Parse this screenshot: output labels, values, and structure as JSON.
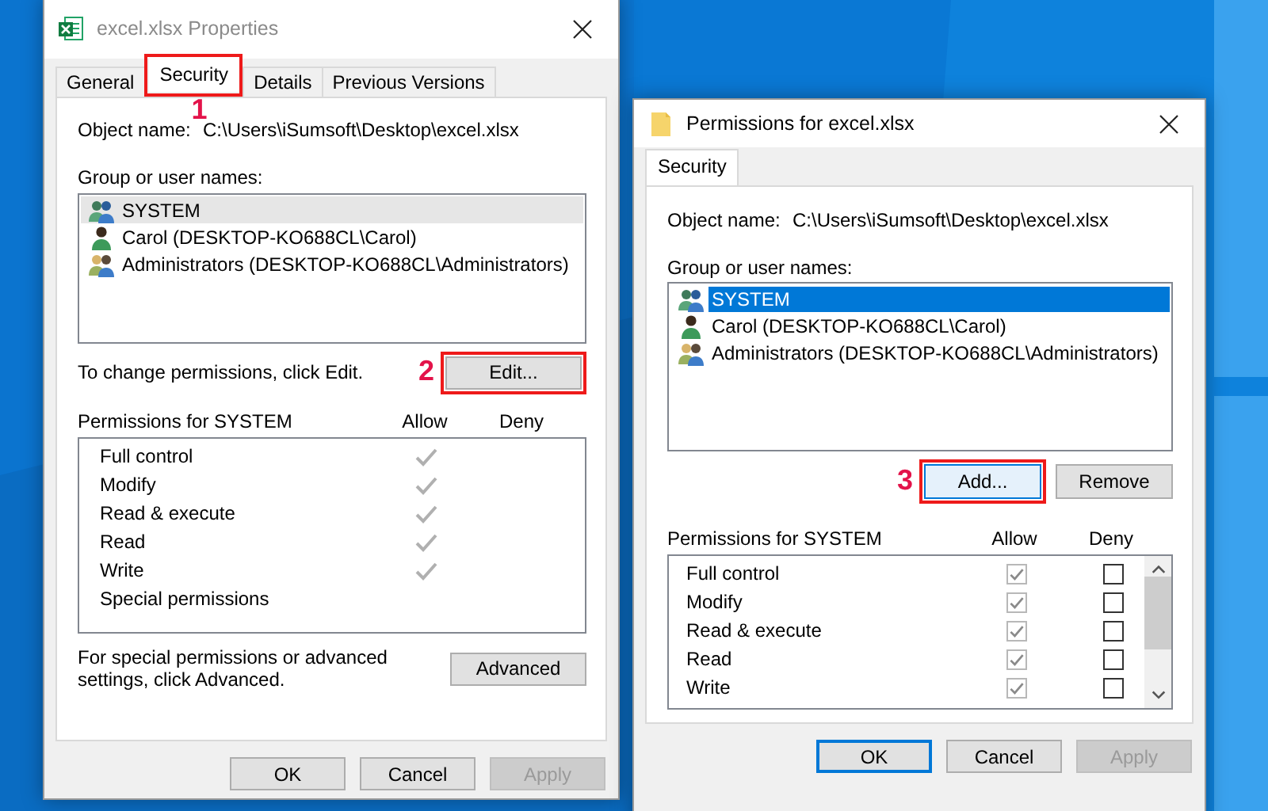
{
  "windows": [
    {
      "title": "excel.xlsx Properties",
      "kind": "properties",
      "active": false,
      "tabs": [
        {
          "label": "General",
          "selected": false,
          "highlighted": false
        },
        {
          "label": "Security",
          "selected": true,
          "highlighted": true,
          "step": "1"
        },
        {
          "label": "Details",
          "selected": false,
          "highlighted": false
        },
        {
          "label": "Previous Versions",
          "selected": false,
          "highlighted": false
        }
      ],
      "object_name_label": "Object name:",
      "object_name": "C:\\Users\\iSumsoft\\Desktop\\excel.xlsx",
      "group_label": "Group or user names:",
      "users": [
        {
          "name": "SYSTEM",
          "kind": "system",
          "selected": true
        },
        {
          "name": "Carol (DESKTOP-KO688CL\\Carol)",
          "kind": "user",
          "selected": false
        },
        {
          "name": "Administrators (DESKTOP-KO688CL\\Administrators)",
          "kind": "group",
          "selected": false
        }
      ],
      "change_hint": "To change permissions, click Edit.",
      "actions": [
        {
          "label": "Edit...",
          "highlighted": true,
          "focused": false,
          "step": "2"
        }
      ],
      "permissions_label": "Permissions for SYSTEM",
      "allow_label": "Allow",
      "deny_label": "Deny",
      "permissions": [
        {
          "name": "Full control",
          "allow": true,
          "deny": false
        },
        {
          "name": "Modify",
          "allow": true,
          "deny": false
        },
        {
          "name": "Read & execute",
          "allow": true,
          "deny": false
        },
        {
          "name": "Read",
          "allow": true,
          "deny": false
        },
        {
          "name": "Write",
          "allow": true,
          "deny": false
        },
        {
          "name": "Special permissions",
          "allow": false,
          "deny": false
        }
      ],
      "advanced_hint": "For special permissions or advanced settings, click Advanced.",
      "advanced_button": "Advanced",
      "buttons": [
        {
          "label": "OK",
          "default": false,
          "disabled": false
        },
        {
          "label": "Cancel",
          "default": false,
          "disabled": false
        },
        {
          "label": "Apply",
          "default": false,
          "disabled": true
        }
      ]
    },
    {
      "title": "Permissions for excel.xlsx",
      "kind": "permissions",
      "active": true,
      "tabs": [
        {
          "label": "Security",
          "selected": true,
          "highlighted": false
        }
      ],
      "object_name_label": "Object name:",
      "object_name": "C:\\Users\\iSumsoft\\Desktop\\excel.xlsx",
      "group_label": "Group or user names:",
      "users": [
        {
          "name": "SYSTEM",
          "kind": "system",
          "selected": true
        },
        {
          "name": "Carol (DESKTOP-KO688CL\\Carol)",
          "kind": "user",
          "selected": false
        },
        {
          "name": "Administrators (DESKTOP-KO688CL\\Administrators)",
          "kind": "group",
          "selected": false
        }
      ],
      "actions": [
        {
          "label": "Add...",
          "highlighted": true,
          "focused": true,
          "step": "3"
        },
        {
          "label": "Remove",
          "highlighted": false,
          "focused": false
        }
      ],
      "permissions_label": "Permissions for SYSTEM",
      "allow_label": "Allow",
      "deny_label": "Deny",
      "permissions": [
        {
          "name": "Full control",
          "allow": true,
          "deny": false
        },
        {
          "name": "Modify",
          "allow": true,
          "deny": false
        },
        {
          "name": "Read & execute",
          "allow": true,
          "deny": false
        },
        {
          "name": "Read",
          "allow": true,
          "deny": false
        },
        {
          "name": "Write",
          "allow": true,
          "deny": false
        }
      ],
      "allow_disabled": true,
      "buttons": [
        {
          "label": "OK",
          "default": true,
          "disabled": false
        },
        {
          "label": "Cancel",
          "default": false,
          "disabled": false
        },
        {
          "label": "Apply",
          "default": false,
          "disabled": true
        }
      ]
    }
  ]
}
